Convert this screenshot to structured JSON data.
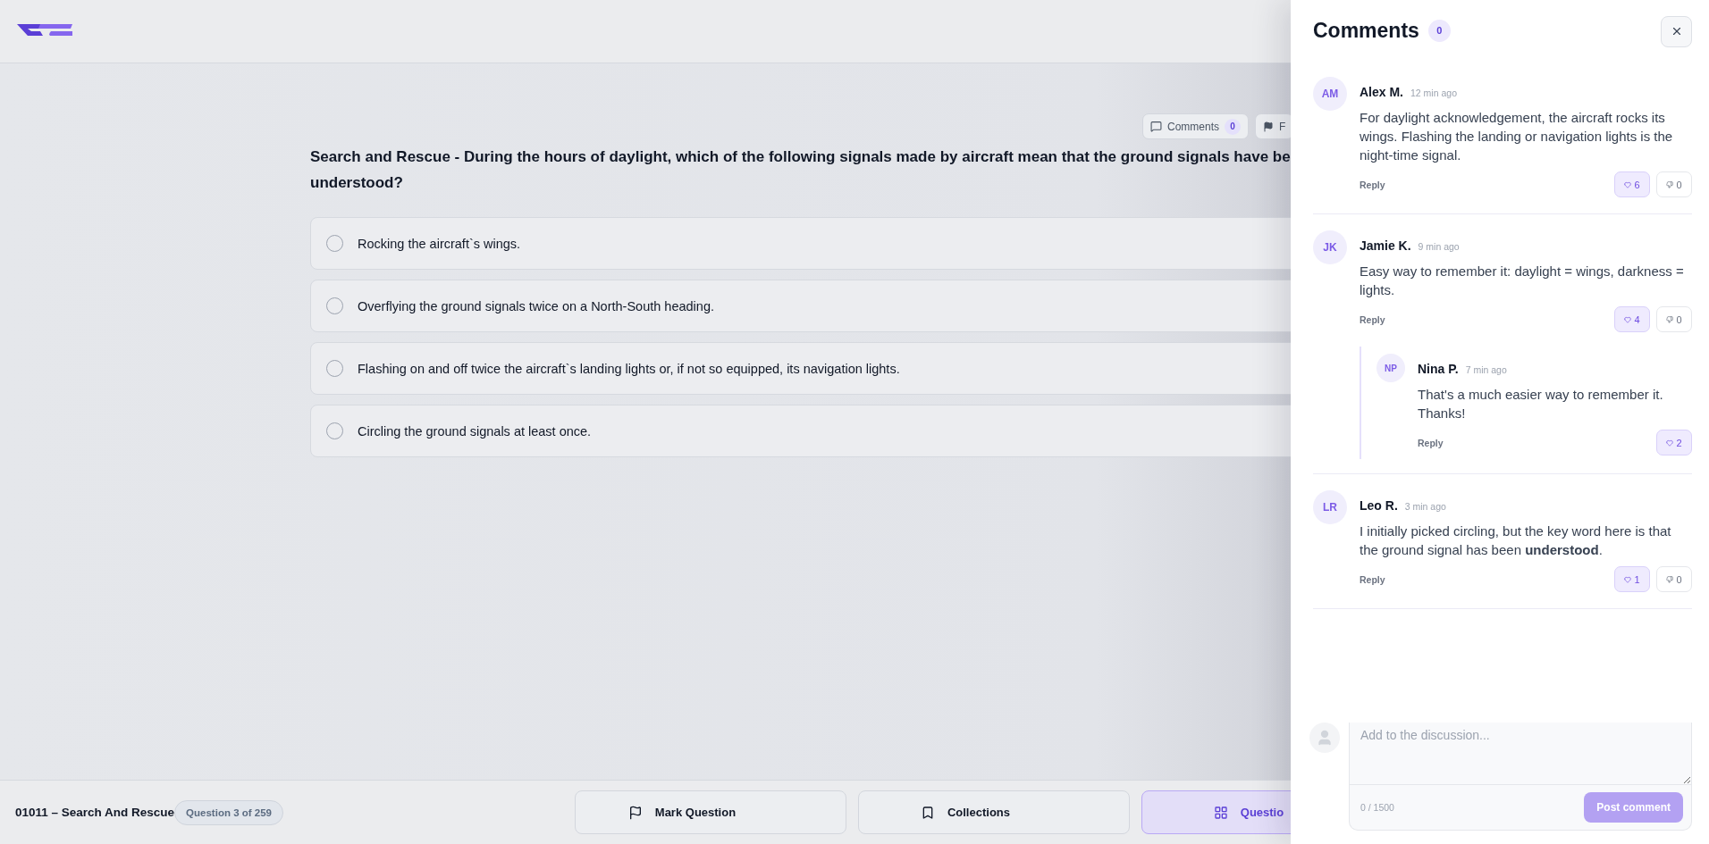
{
  "question_toolbar": [
    {
      "kind": "comments",
      "label": "Comments",
      "count": "0"
    },
    {
      "kind": "flag",
      "label": "F"
    }
  ],
  "question": {
    "text": "Search and Rescue - During the hours of daylight, which of the following signals made by aircraft mean that the ground signals have be\nunderstood?"
  },
  "options": [
    {
      "label": "Rocking the aircraft`s wings.",
      "selected": false
    },
    {
      "label": "Overflying the ground signals twice on a North-South heading.",
      "selected": false
    },
    {
      "label": "Flashing on and off twice the aircraft`s landing lights or, if not so equipped, its navigation lights.",
      "selected": false
    },
    {
      "label": "Circling the ground signals at least once.",
      "selected": false
    }
  ],
  "status_bar": {
    "title": "01011 – Search And Rescue",
    "progress": "Question 3 of 259",
    "buttons": [
      {
        "kind": "flag",
        "label": "Mark Question",
        "selected": false
      },
      {
        "kind": "bookmark",
        "label": "Collections",
        "selected": false
      },
      {
        "kind": "grid",
        "label": "Questio",
        "selected": true
      }
    ]
  },
  "comments_panel": {
    "title": "Comments",
    "count": "0",
    "comments": [
      {
        "initials": "AM",
        "author": "Alex M.",
        "time": "12 min ago",
        "text": "For daylight acknowledgement, the aircraft rocks its wings. Flashing the landing or navigation lights is the night-time signal.",
        "reply": "Reply",
        "votes": [
          {
            "kind": "up",
            "count": "6"
          },
          {
            "kind": "down",
            "count": "0"
          }
        ]
      },
      {
        "initials": "JK",
        "author": "Jamie K.",
        "time": "9 min ago",
        "text": "Easy way to remember it: daylight = wings, darkness = lights.",
        "reply": "Reply",
        "votes": [
          {
            "kind": "up",
            "count": "4"
          },
          {
            "kind": "down",
            "count": "0"
          }
        ],
        "children": [
          {
            "initials": "NP",
            "author": "Nina P.",
            "time": "7 min ago",
            "text": "That's a much easier way to remember it. Thanks!",
            "reply": "Reply",
            "votes": [
              {
                "kind": "up",
                "count": "2"
              }
            ]
          }
        ]
      },
      {
        "initials": "LR",
        "author": "Leo R.",
        "time": "3 min ago",
        "text": "I initially picked circling, but the key word here is that the ground signal has been **understood**.",
        "reply": "Reply",
        "votes": [
          {
            "kind": "up",
            "count": "1"
          },
          {
            "kind": "down",
            "count": "0"
          }
        ]
      }
    ],
    "composer": {
      "placeholder": "Add to the discussion...",
      "counter": "0 / 1500",
      "submit": "Post comment"
    }
  }
}
